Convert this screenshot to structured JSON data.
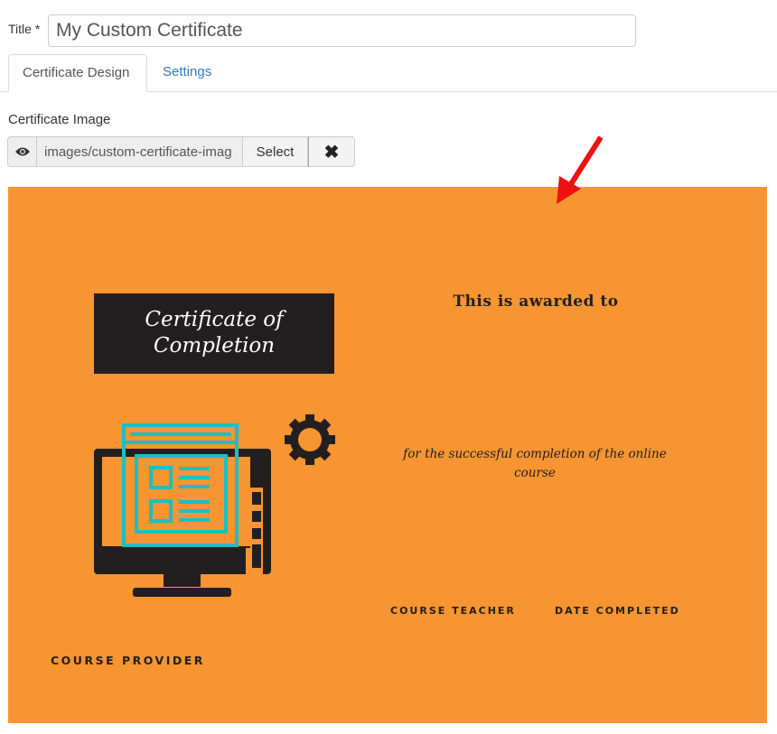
{
  "form": {
    "title_label": "Title *",
    "title_value": "My Custom Certificate"
  },
  "tabs": [
    {
      "label": "Certificate Design",
      "active": true
    },
    {
      "label": "Settings",
      "active": false
    }
  ],
  "certificate_image": {
    "label": "Certificate Image",
    "path": "images/custom-certificate-imag",
    "select_label": "Select",
    "clear_icon": "close-icon",
    "preview_icon": "eye-icon"
  },
  "certificate": {
    "background": "#f69532",
    "dark": "#231f20",
    "accent": "#1bbfc4",
    "heading_line1": "Certificate of",
    "heading_line2": "Completion",
    "awarded": "This is awarded to",
    "completion_text": "for the successful completion of the online course",
    "course_teacher": "COURSE TEACHER",
    "date_completed": "DATE COMPLETED",
    "course_provider": "COURSE PROVIDER"
  },
  "annotation": {
    "arrow_color": "#ee1111"
  }
}
